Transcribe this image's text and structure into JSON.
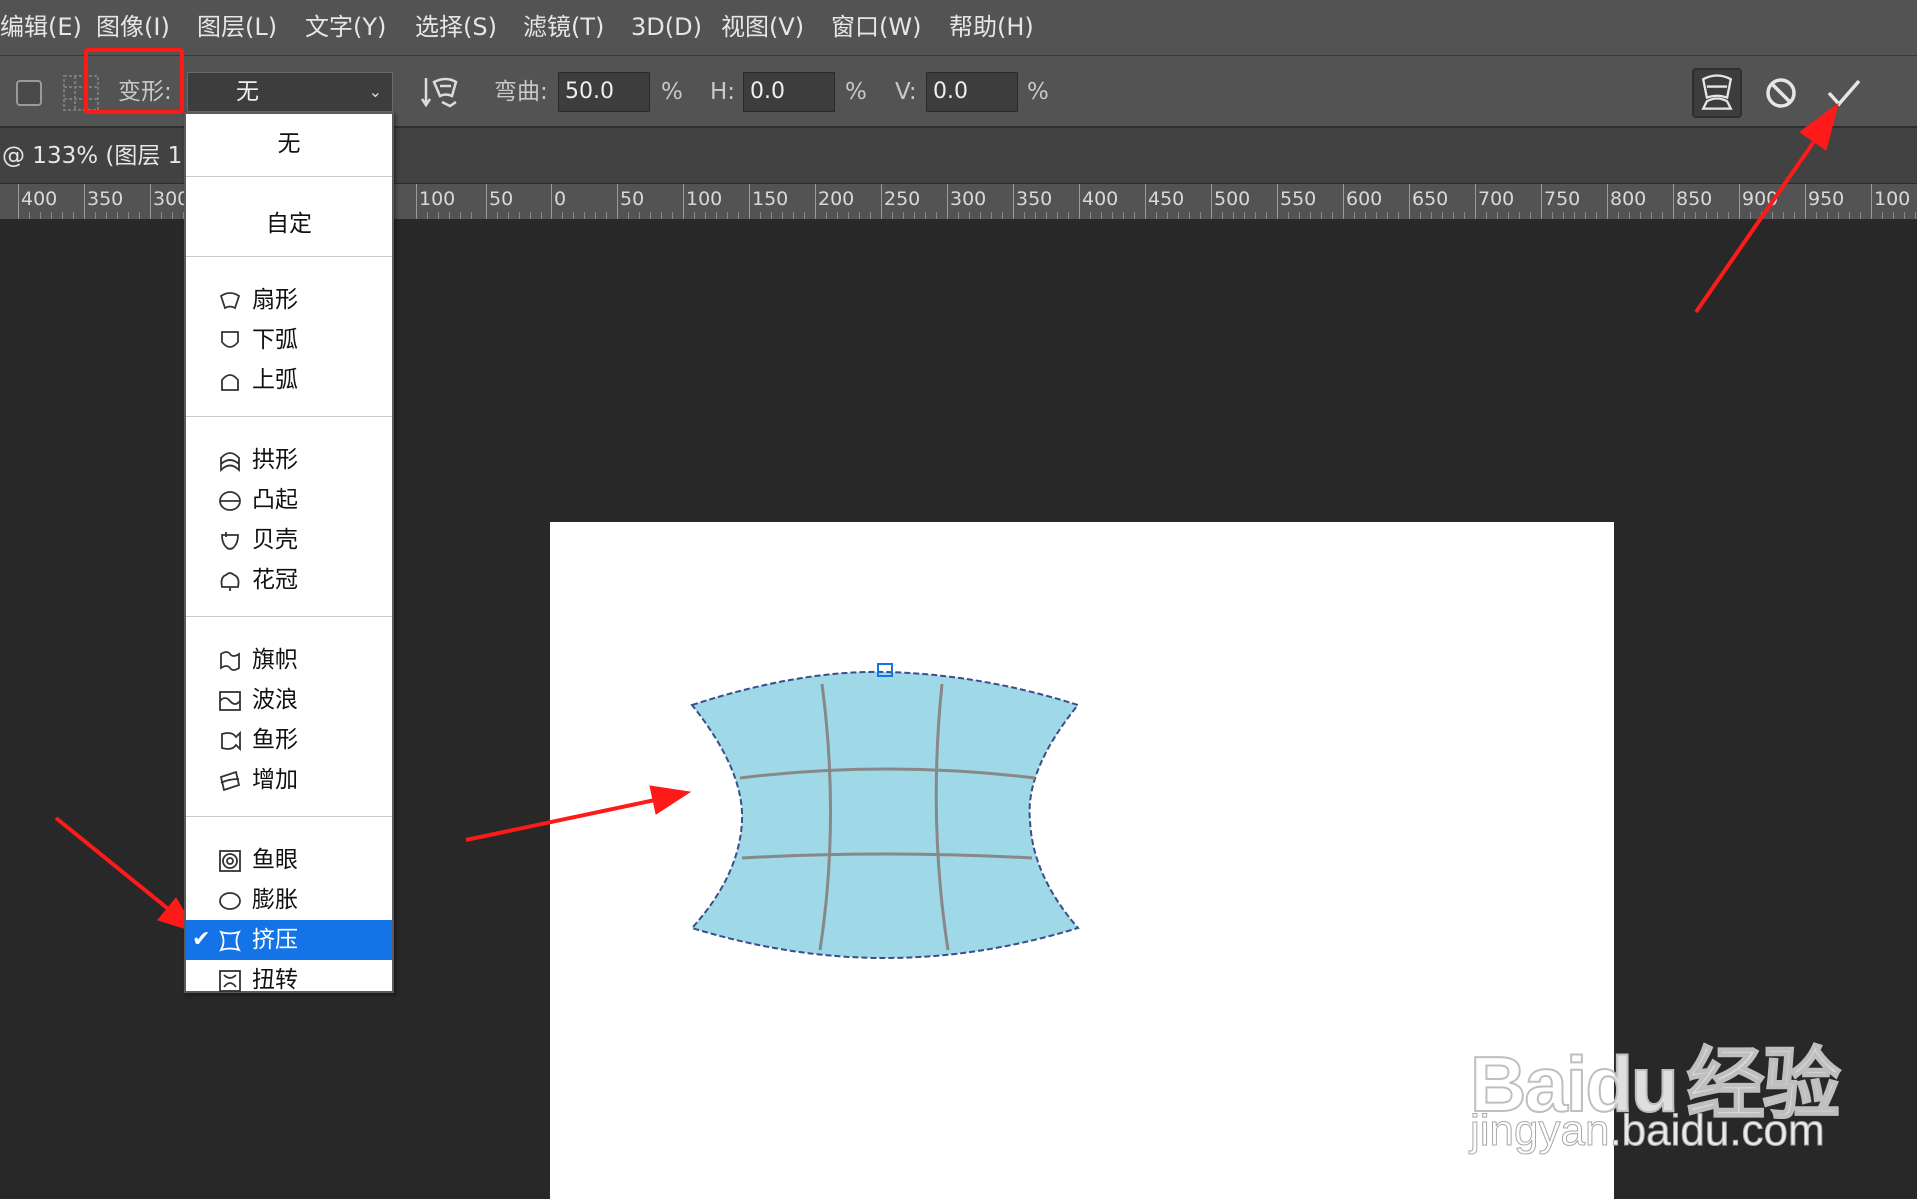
{
  "menu": [
    "编辑(E)",
    "图像(I)",
    "图层(L)",
    "文字(Y)",
    "选择(S)",
    "滤镜(T)",
    "3D(D)",
    "视图(V)",
    "窗口(W)",
    "帮助(H)"
  ],
  "options": {
    "warp_label": "变形:",
    "warp_value": "无",
    "bend_label": "弯曲:",
    "bend_value": "50.0",
    "percent": "%",
    "h_label": "H:",
    "h_value": "0.0",
    "v_label": "V:",
    "v_value": "0.0"
  },
  "doc_tab": "@ 133% (图层 1,",
  "ruler": [
    "400",
    "350",
    "300",
    "100",
    "50",
    "0",
    "50",
    "100",
    "150",
    "200",
    "250",
    "300",
    "350",
    "400",
    "450",
    "500",
    "550",
    "600",
    "650",
    "700",
    "750",
    "800",
    "850",
    "900",
    "950",
    "100"
  ],
  "dropdown": {
    "items": [
      {
        "label": "无",
        "icon": "none"
      },
      {
        "label": "自定",
        "icon": "none"
      },
      {
        "label": "扇形",
        "icon": "arc-icon"
      },
      {
        "label": "下弧",
        "icon": "arc-lower-icon"
      },
      {
        "label": "上弧",
        "icon": "arc-upper-icon"
      },
      {
        "label": "拱形",
        "icon": "arch-icon"
      },
      {
        "label": "凸起",
        "icon": "bulge-icon"
      },
      {
        "label": "贝壳",
        "icon": "shell-lower-icon"
      },
      {
        "label": "花冠",
        "icon": "shell-upper-icon"
      },
      {
        "label": "旗帜",
        "icon": "flag-icon"
      },
      {
        "label": "波浪",
        "icon": "wave-icon"
      },
      {
        "label": "鱼形",
        "icon": "fish-icon"
      },
      {
        "label": "增加",
        "icon": "rise-icon"
      },
      {
        "label": "鱼眼",
        "icon": "fisheye-icon"
      },
      {
        "label": "膨胀",
        "icon": "inflate-icon"
      },
      {
        "label": "挤压",
        "icon": "squeeze-icon",
        "selected": true
      },
      {
        "label": "扭转",
        "icon": "twist-icon"
      }
    ]
  },
  "watermark": {
    "logo_text": "Bai",
    "logo_text2": "du",
    "logo_cn": "经验",
    "url": "jingyan.baidu.com"
  },
  "colors": {
    "accent": "#1473e6",
    "annotation": "#ff1a1a",
    "shape_fill": "#9fd8e6",
    "panel": "#535353",
    "workspace": "#282828"
  }
}
